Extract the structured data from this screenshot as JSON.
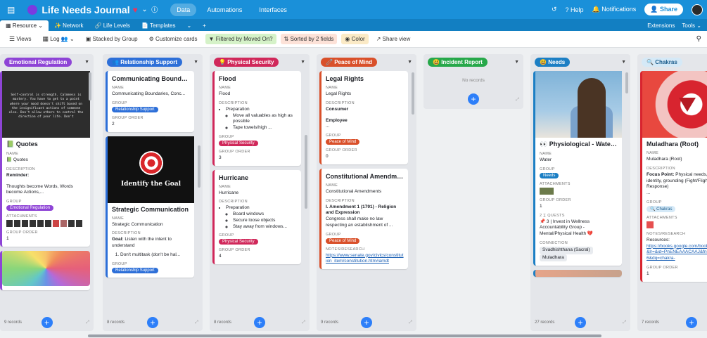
{
  "topbar": {
    "title": "Life Needs Journal",
    "nav": [
      "Data",
      "Automations",
      "Interfaces"
    ],
    "help": "Help",
    "notifications": "Notifications",
    "share": "Share"
  },
  "tabs": {
    "items": [
      "Resource",
      "Network",
      "Life Levels",
      "Templates"
    ],
    "right": [
      "Extensions",
      "Tools"
    ]
  },
  "toolbar": {
    "views": "Views",
    "log": "Log",
    "stacked": "Stacked by Group",
    "customize": "Customize cards",
    "filter": "Filtered by Moved On?",
    "sort": "Sorted by 2 fields",
    "color": "Color",
    "share_view": "Share view"
  },
  "labels": {
    "name": "NAME",
    "description": "DESCRIPTION",
    "group": "GROUP",
    "group_order": "GROUP ORDER",
    "attachments": "ATTACHMENTS",
    "notes": "NOTES/RESEARCH",
    "quests": "QUESTS",
    "connection": "CONNECTION"
  },
  "columns": [
    {
      "label": "Emotional Regulation",
      "color": "#8e44d6",
      "footer": "9 records"
    },
    {
      "label": "Relationship Support",
      "color": "#2d6fd8",
      "footer": "8 records"
    },
    {
      "label": "Physical Security",
      "color": "#d0285a",
      "footer": "8 records"
    },
    {
      "label": "Peace of Mind",
      "color": "#d9502a",
      "footer": "9 records"
    },
    {
      "label": "Incident Report",
      "color": "#27a84a",
      "footer": "",
      "empty": "No records"
    },
    {
      "label": "Needs",
      "color": "#1c7fc4",
      "footer": "27 records"
    },
    {
      "label": "Chakras",
      "color": "#d5e9f7",
      "footer": "7 records"
    }
  ],
  "cards": {
    "quotes": {
      "img": "Self-control is strength. Calmness is mastery. You have to get to a point where your mood doesn't shift based on the insignificant actions of someone else. Don't allow others to control the direction of your life. Don't",
      "title": "Quotes",
      "name": "Quotes",
      "desc_head": "Reminder:",
      "desc_body": "Thoughts become Words, Words become Actions,...",
      "group": "Emotional Regulation",
      "order": "1"
    },
    "comm": {
      "title": "Communicating Boundarie...",
      "name": "Communicating Boundaries, Conc...",
      "group": "Relationship Support",
      "order": "2"
    },
    "strat": {
      "img": "Identify the Goal",
      "title": "Strategic Communication",
      "name": "Strategic Communication",
      "desc_bold": "Goal:",
      "desc_body": " Listen with the intent to understand",
      "li1": "Don't multitask (don't be hal...",
      "group": "Relationship Support"
    },
    "flood": {
      "title": "Flood",
      "name": "Flood",
      "li": "Preparation",
      "sub1": "Move all valuables as high as possible",
      "sub2": "Tape towels/high ...",
      "group": "Physical Security",
      "order": "3"
    },
    "hurr": {
      "title": "Hurricane",
      "name": "Hurricane",
      "li": "Preparation",
      "sub1": "Board windows",
      "sub2": "Secure loose objects",
      "sub3": "Stay away from windows...",
      "group": "Physical Security",
      "order": "4"
    },
    "legal": {
      "title": "Legal Rights",
      "name": "Legal Rights",
      "d1": "Consumer",
      "d2": "Employee",
      "d3": "...",
      "group": "Peace of Mind",
      "order": "0"
    },
    "const": {
      "title": "Constitutional Amendments",
      "name": "Constitutional Amendments",
      "d1": "I. Amendment 1 (1791) - Religion and Expression",
      "d2": "Congress shall make no law respecting an establishment of ...",
      "group": "Peace of Mind",
      "link": "https://www.senate.gov/civics/constitution_item/constitution.htm#amdt"
    },
    "water": {
      "title": "Physiological - Water ...",
      "name": "Water",
      "group": "Needs",
      "order": "1",
      "quests_n": "2",
      "quest": "3 | Invest in Wellness Accountability Group - Mental/Physical Health",
      "conn1": "Svadhishthana (Sacral)",
      "conn2": "Muladhara"
    },
    "mula": {
      "title": "Muladhara (Root)",
      "name": "Muladhara (Root)",
      "focus_b": "Focus Point:",
      "focus": " Physical needs, stability, identity, grounding (Fight/Flight Response)",
      "dots": "...",
      "group": "Chakras",
      "notes_h": "Resources:",
      "link": "https://books.google.com/books?hl=en&lr=&id=PnENEAAACAAJ&fnd&pg=PA6&dq=chakra-",
      "order": "1"
    }
  }
}
